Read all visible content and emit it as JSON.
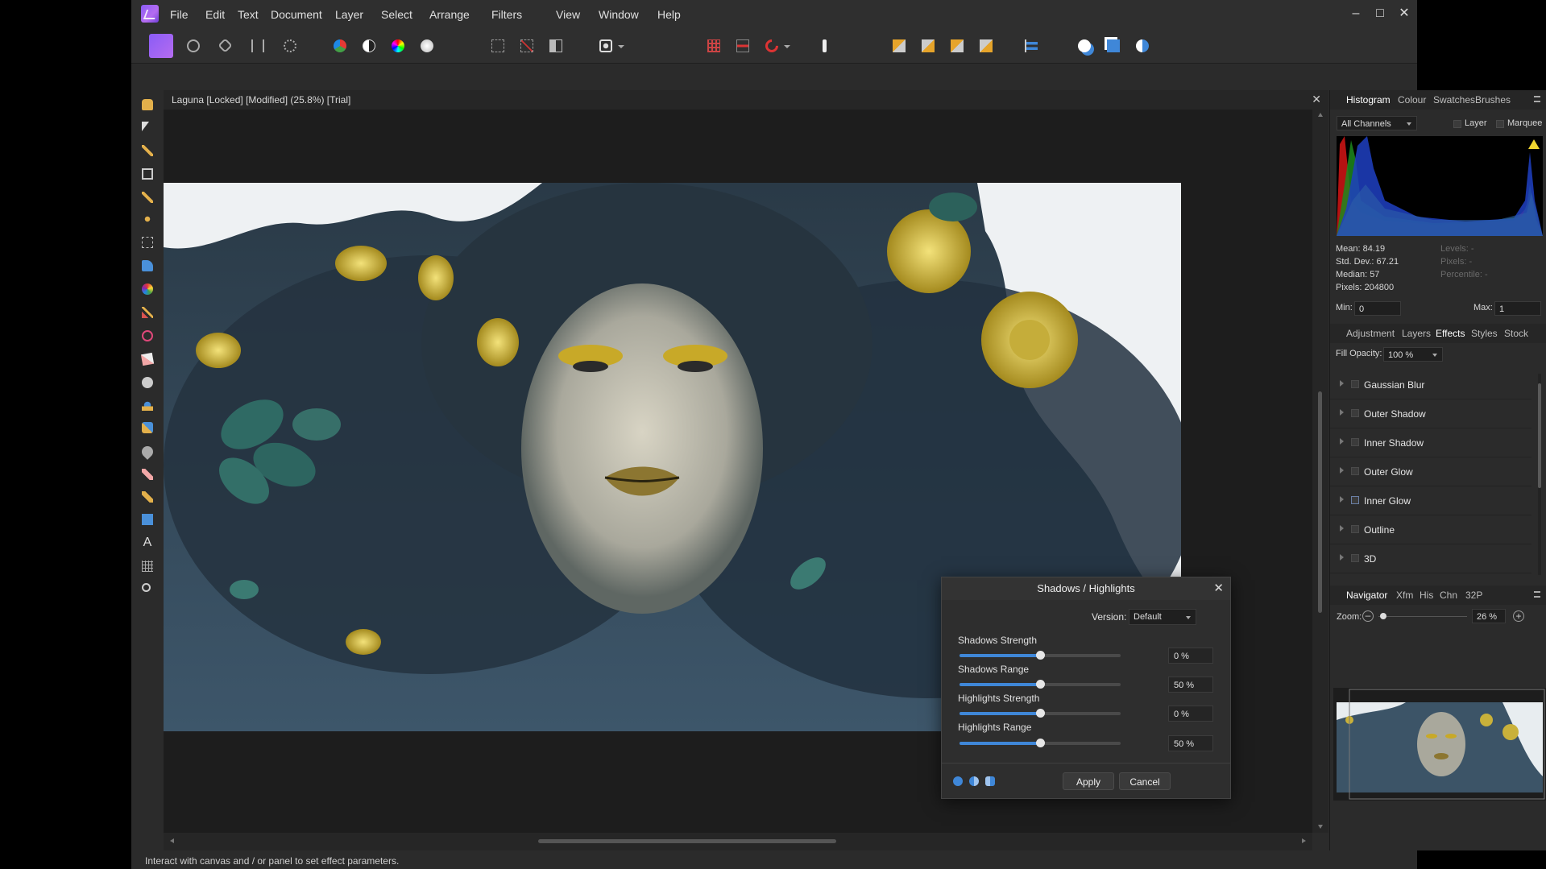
{
  "menu": {
    "items": [
      "File",
      "Edit",
      "Text",
      "Document",
      "Layer",
      "Select",
      "Arrange",
      "Filters",
      "View",
      "Window",
      "Help"
    ]
  },
  "window_controls": {
    "minimize": "–",
    "maximize": "□",
    "close": "✕"
  },
  "document": {
    "title": "Laguna [Locked] [Modified] (25.8%) [Trial]",
    "close": "✕"
  },
  "status": {
    "text": "Interact with canvas and / or panel to set effect parameters."
  },
  "histogram_panel": {
    "tabs": [
      "Histogram",
      "Colour",
      "Swatches",
      "Brushes"
    ],
    "active_tab": "Histogram",
    "channels": "All Channels",
    "layer_label": "Layer",
    "marquee_label": "Marquee",
    "stats": {
      "mean": "Mean: 84.19",
      "std_dev": "Std. Dev.: 67.21",
      "median": "Median: 57",
      "pixels": "Pixels: 204800"
    },
    "stats_right": {
      "levels": "Levels: -",
      "pixels": "Pixels: -",
      "percentile": "Percentile: -"
    },
    "min_label": "Min:",
    "min_value": "0",
    "max_label": "Max:",
    "max_value": "1",
    "warning_icon": "warning-triangle-icon"
  },
  "effects_panel": {
    "tabs": [
      "Adjustment",
      "Layers",
      "Effects",
      "Styles",
      "Stock"
    ],
    "active_tab": "Effects",
    "fill_opacity_label": "Fill Opacity:",
    "fill_opacity_value": "100 %",
    "effects": [
      "Gaussian Blur",
      "Outer Shadow",
      "Inner Shadow",
      "Outer Glow",
      "Inner Glow",
      "Outline",
      "3D"
    ]
  },
  "navigator_panel": {
    "tabs": [
      "Navigator",
      "Xfm",
      "His",
      "Chn",
      "32P"
    ],
    "active_tab": "Navigator",
    "zoom_label": "Zoom:",
    "zoom_value": "26 %",
    "zoom_level": 0.05
  },
  "dialog": {
    "title": "Shadows / Highlights",
    "version_label": "Version:",
    "version_value": "Default",
    "sliders": [
      {
        "label": "Shadows Strength",
        "value": "0 %",
        "fraction": 0.5
      },
      {
        "label": "Shadows Range",
        "value": "50 %",
        "fraction": 0.5
      },
      {
        "label": "Highlights Strength",
        "value": "0 %",
        "fraction": 0.5
      },
      {
        "label": "Highlights Range",
        "value": "50 %",
        "fraction": 0.5
      }
    ],
    "apply_label": "Apply",
    "cancel_label": "Cancel"
  },
  "colors": {
    "accent": "#3f87d8",
    "panel_bg": "#2b2b2b",
    "canvas_bg": "#1d1d1d"
  }
}
